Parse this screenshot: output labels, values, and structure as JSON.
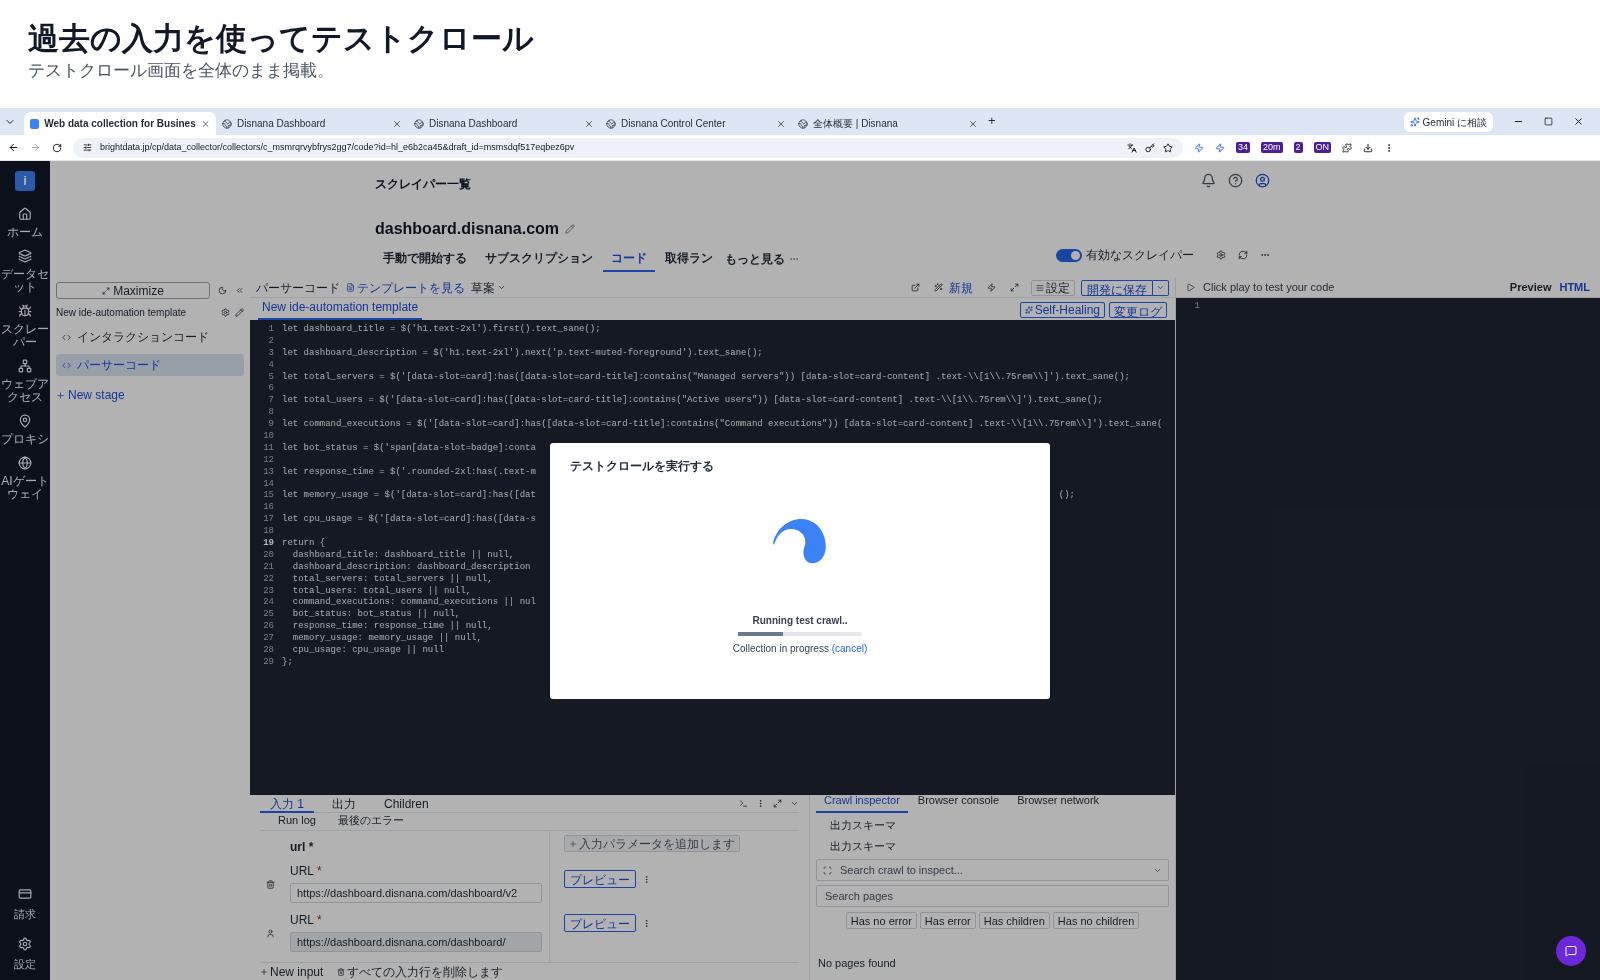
{
  "page_header": {
    "title": "過去の入力を使ってテストクロール",
    "subtitle": "テストクロール画面を全体のまま掲載。"
  },
  "browser": {
    "tabs": [
      {
        "title": "Web data collection for Busines",
        "selected": true
      },
      {
        "title": "Disnana Dashboard",
        "selected": false
      },
      {
        "title": "Disnana Dashboard",
        "selected": false
      },
      {
        "title": "Disnana Control Center",
        "selected": false
      },
      {
        "title": "全体概要 | Disnana",
        "selected": false
      }
    ],
    "new_tab": "+",
    "gemini": "Gemini に相談",
    "url": "brightdata.jp/cp/data_collector/collectors/c_msmrqrvybfrys2gg7/code?id=hl_e6b2ca45&draft_id=msmsdqf517eqbez6pv",
    "extension_badges": [
      "34",
      "20m",
      "2",
      "ON"
    ]
  },
  "sidebar": {
    "logo": "i",
    "items": [
      {
        "label": "ホーム"
      },
      {
        "label": "データセット"
      },
      {
        "label": "スクレーパー"
      },
      {
        "label": "ウェブアクセス"
      },
      {
        "label": "プロキシ"
      },
      {
        "label": "AIゲートウェイ"
      }
    ],
    "bottom_items": [
      {
        "label": "請求"
      },
      {
        "label": "設定"
      }
    ]
  },
  "app": {
    "breadcrumb": "スクレイパー一覧",
    "title": "dashboard.disnana.com",
    "nav_tabs": [
      {
        "label": "手動で開始する",
        "selected": false
      },
      {
        "label": "サブスクリプション",
        "selected": false
      },
      {
        "label": "コード",
        "selected": true
      },
      {
        "label": "取得ラン",
        "selected": false
      }
    ],
    "more": "もっと見る",
    "toggle": {
      "label": "有効なスクレイパー",
      "on": true
    }
  },
  "left_panel": {
    "maximize": "Maximize",
    "template": "New ide-automation template",
    "items": [
      {
        "label": "インタラクションコード",
        "selected": false
      },
      {
        "label": "パーサーコード",
        "selected": true
      }
    ],
    "new_stage": "New stage"
  },
  "editor": {
    "label": "パーサーコード",
    "template_link": "テンプレートを見る",
    "draft": "草案",
    "new": "新規",
    "settings": "設定",
    "save": "開発に保存",
    "tab": "New ide-automation template",
    "self_healing": "Self-Healing",
    "changelog": "変更ログ",
    "lines": [
      {
        "n": "1",
        "text": "let dashboard_title = $('h1.text-2xl').first().text_sane();",
        "current": false
      },
      {
        "n": "2",
        "current": false
      },
      {
        "n": "3",
        "text": "let dashboard_description = $('h1.text-2xl').next('p.text-muted-foreground').text_sane();",
        "current": false
      },
      {
        "n": "4",
        "current": false
      },
      {
        "n": "5",
        "text": "let total_servers = $('[data-slot=card]:has([data-slot=card-title]:contains(\"Managed servers\")) [data-slot=card-content] .text-\\\\[1\\\\.75rem\\\\]').text_sane();",
        "current": false
      },
      {
        "n": "6",
        "current": false
      },
      {
        "n": "7",
        "text": "let total_users = $('[data-slot=card]:has([data-slot=card-title]:contains(\"Active users\")) [data-slot=card-content] .text-\\\\[1\\\\.75rem\\\\]').text_sane();",
        "current": false
      },
      {
        "n": "8",
        "current": false
      },
      {
        "n": "9",
        "text": "let command_executions = $('[data-slot=card]:has([data-slot=card-title]:contains(\"Command executions\")) [data-slot=card-content] .text-\\\\[1\\\\.75rem\\\\]').text_sane(",
        "current": false
      },
      {
        "n": "10",
        "current": false
      },
      {
        "n": "11",
        "text": "let bot_status = $('span[data-slot=badge]:conta",
        "current": false
      },
      {
        "n": "12",
        "current": false
      },
      {
        "n": "13",
        "text": "let response_time = $('.rounded-2xl:has(.text-m",
        "current": false
      },
      {
        "n": "14",
        "current": false
      },
      {
        "n": "15",
        "text": "let memory_usage = $('[data-slot=card]:has([dat",
        "tail": "();",
        "current": false
      },
      {
        "n": "16",
        "current": false
      },
      {
        "n": "17",
        "text": "let cpu_usage = $('[data-slot=card]:has([data-s",
        "current": false
      },
      {
        "n": "18",
        "current": false
      },
      {
        "n": "19",
        "text": "return {",
        "current": true
      },
      {
        "n": "20",
        "text": "  dashboard_title: dashboard_title || null,",
        "current": false
      },
      {
        "n": "21",
        "text": "  dashboard_description: dashboard_description",
        "current": false
      },
      {
        "n": "22",
        "text": "  total_servers: total_servers || null,",
        "current": false
      },
      {
        "n": "23",
        "text": "  total_users: total_users || null,",
        "current": false
      },
      {
        "n": "24",
        "text": "  command_executions: command_executions || nul",
        "current": false
      },
      {
        "n": "25",
        "text": "  bot_status: bot_status || null,",
        "current": false
      },
      {
        "n": "26",
        "text": "  response_time: response_time || null,",
        "current": false
      },
      {
        "n": "27",
        "text": "  memory_usage: memory_usage || null,",
        "current": false
      },
      {
        "n": "28",
        "text": "  cpu_usage: cpu_usage || null",
        "current": false
      },
      {
        "n": "29",
        "text": "};",
        "current": false
      }
    ]
  },
  "right_panel": {
    "hint": "Click play to test your code",
    "tabs": [
      {
        "label": "Preview",
        "selected": false
      },
      {
        "label": "HTML",
        "selected": true
      }
    ],
    "line_number": "1"
  },
  "inputs_panel": {
    "tabs": [
      {
        "label": "入力",
        "count": "1",
        "selected": true
      },
      {
        "label": "出力",
        "selected": false
      },
      {
        "label": "Children",
        "selected": false
      }
    ],
    "subtabs": [
      {
        "label": "Run log",
        "selected": false
      },
      {
        "label": "最後のエラー",
        "selected": false
      }
    ],
    "param": "url",
    "param_mark": "*",
    "add_param": "入力パラメータを追加します",
    "rows": [
      {
        "kind": "trash",
        "label": "URL",
        "required": true,
        "required_mark": "*",
        "value": "https://dashboard.disnana.com/dashboard/v2",
        "preview": "プレビュー"
      },
      {
        "kind": "person",
        "label": "URL",
        "required": true,
        "required_mark": "*",
        "value": "https://dashboard.disnana.com/dashboard/",
        "preview": "プレビュー"
      }
    ],
    "new_input": "New input",
    "delete_all": "すべての入力行を削除します"
  },
  "inspector": {
    "tabs": [
      {
        "label": "Crawl inspector",
        "selected": true
      },
      {
        "label": "Browser console",
        "selected": false
      },
      {
        "label": "Browser network",
        "selected": false
      }
    ],
    "schema_rows": [
      "出力スキーマ",
      "出力スキーマ"
    ],
    "crawl_search": {
      "placeholder": "Search crawl to inspect..."
    },
    "pages_search": {
      "placeholder": "Search pages"
    },
    "filters": [
      "Has no error",
      "Has error",
      "Has children",
      "Has no children"
    ],
    "empty": "No pages found"
  },
  "modal": {
    "title": "テストクロールを実行する",
    "status": "Running test crawl..",
    "progress": {
      "level": 0.36
    },
    "note": "Collection in progress",
    "cancel": "(cancel)"
  }
}
